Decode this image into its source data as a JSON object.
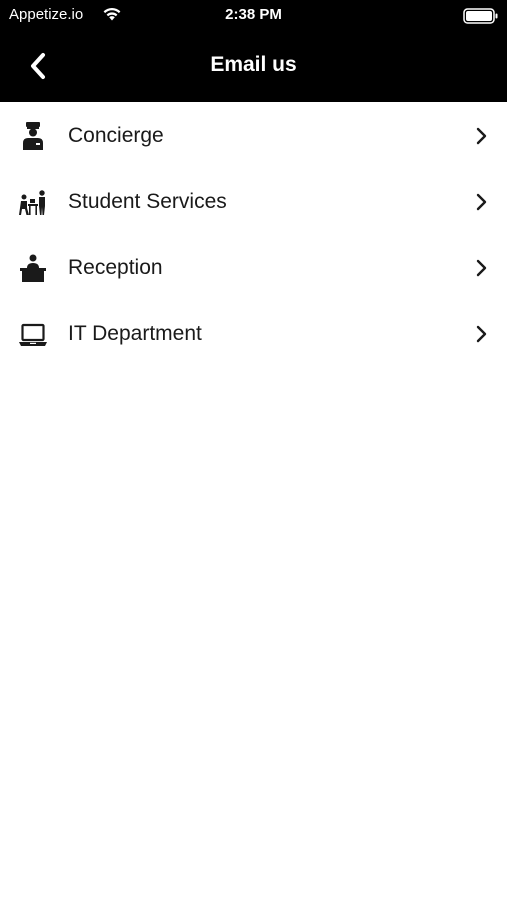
{
  "status_bar": {
    "carrier": "Appetize.io",
    "time": "2:38 PM",
    "wifi_icon": "wifi-icon",
    "battery_icon": "battery-icon"
  },
  "nav": {
    "title": "Email us",
    "back_icon": "chevron-left-icon"
  },
  "items": [
    {
      "label": "Concierge",
      "icon": "concierge-icon"
    },
    {
      "label": "Student Services",
      "icon": "student-services-icon"
    },
    {
      "label": "Reception",
      "icon": "reception-icon"
    },
    {
      "label": "IT Department",
      "icon": "laptop-icon"
    }
  ],
  "colors": {
    "header_bg": "#000000",
    "header_text": "#ffffff",
    "body_bg": "#ffffff",
    "item_text": "#1a1a1a"
  }
}
